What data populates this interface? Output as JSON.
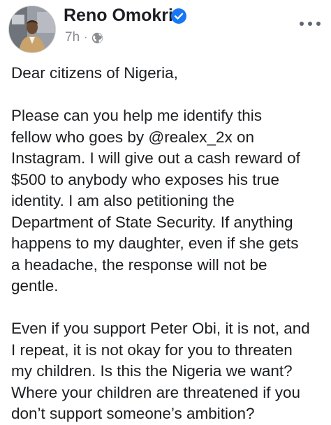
{
  "post": {
    "author": "Reno Omokri",
    "time": "7h",
    "separator": "·",
    "privacy_icon": "globe-icon",
    "verified_icon": "verified-badge-icon",
    "more_icon": "more-options-icon",
    "accent_color": "#1877f2",
    "lines": [
      "Dear citizens of Nigeria,",
      "Please can you help me identify this",
      "fellow who goes by @realex_2x on",
      "Instagram. I will give out a cash reward of",
      "$500 to anybody who exposes his true",
      "identity. I am also petitioning the",
      "Department of State Security. If anything",
      "happens to my daughter, even if she gets",
      "a headache, the response will not be",
      "gentle.",
      "Even if you support Peter Obi, it is not, and",
      "I repeat, it is not okay for you to threaten",
      "my children. Is this the Nigeria we want?",
      "Where your children are threatened if you",
      "don’t support someone’s ambition?"
    ]
  }
}
